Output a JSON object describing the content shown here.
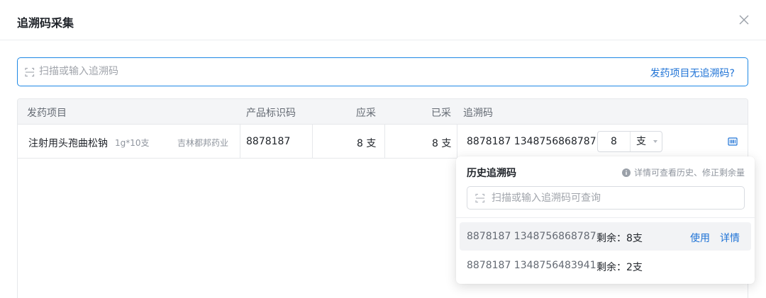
{
  "modal": {
    "title": "追溯码采集"
  },
  "scan": {
    "placeholder": "扫描或输入追溯码",
    "no_code_link": "发药项目无追溯码?"
  },
  "table": {
    "headers": [
      "发药项目",
      "产品标识码",
      "应采",
      "已采",
      "追溯码"
    ],
    "rows": [
      {
        "drug_name": "注射用头孢曲松钠",
        "spec": "1g*10支",
        "manufacturer": "吉林都邦药业",
        "product_code": "8878187",
        "required": "8 支",
        "collected": "8 支",
        "trace_code": "8878187  1348756868787",
        "qty": "8",
        "unit": "支"
      }
    ]
  },
  "history": {
    "title": "历史追溯码",
    "hint": "详情可查看历史、修正剩余量",
    "search_placeholder": "扫描或输入追溯码可查询",
    "items": [
      {
        "code": "8878187  1348756868787",
        "remain": "剩余：8支",
        "use_label": "使用",
        "detail_label": "详情"
      },
      {
        "code": "8878187  1348756483941",
        "remain": "剩余：2支"
      }
    ]
  },
  "colors": {
    "accent": "#1f73d6",
    "input_border": "#1e88e5",
    "header_bg": "#f4f5f7"
  },
  "icons": {
    "close": "close-icon",
    "scan": "scan-icon",
    "barcode": "barcode-icon",
    "info": "info-icon"
  }
}
